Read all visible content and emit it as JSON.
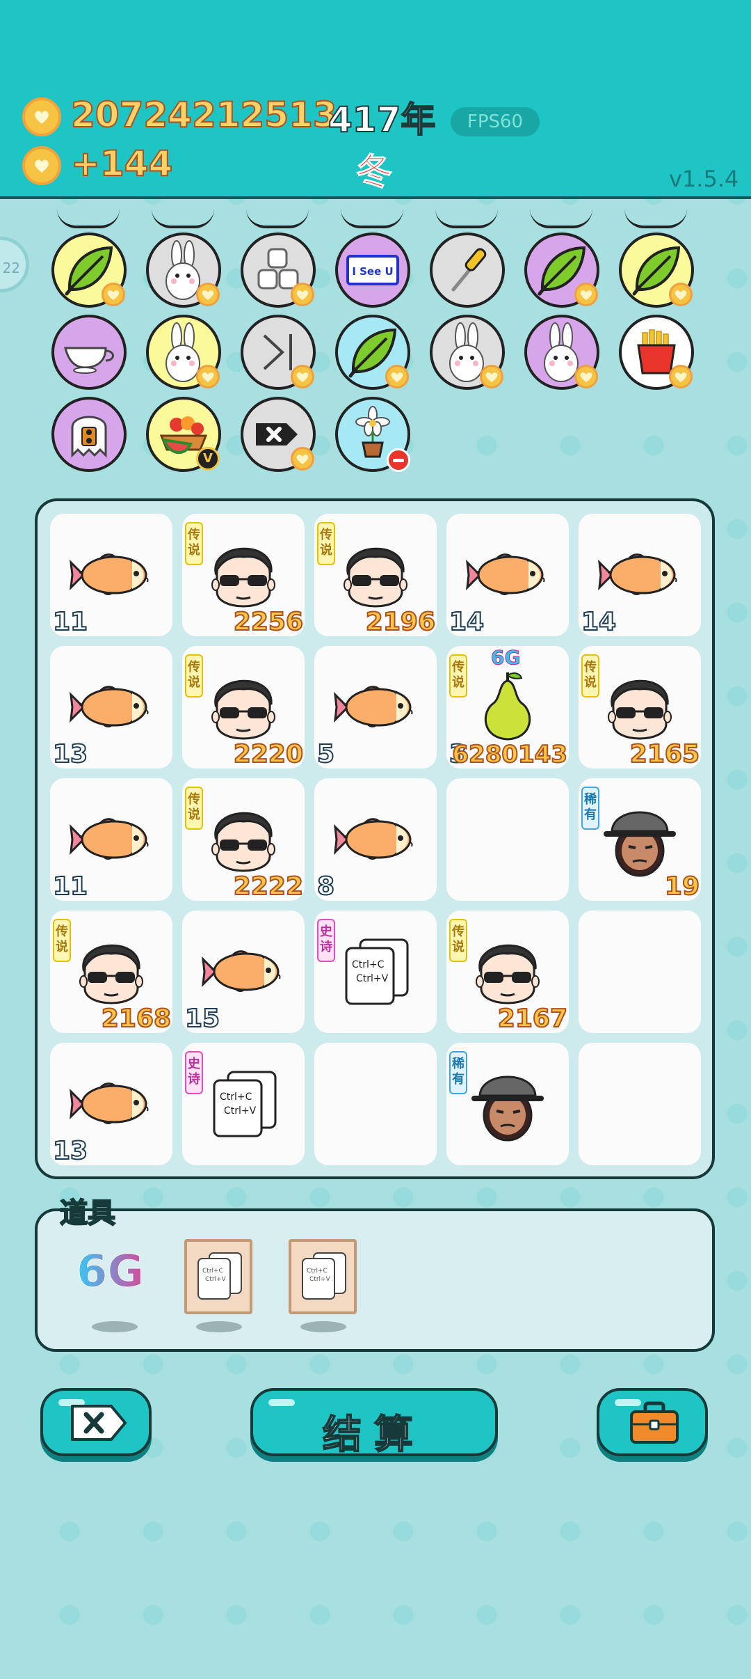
{
  "hud": {
    "coins": "20724212513",
    "income": "+144",
    "year": "417年",
    "season": "冬",
    "fps": "FPS60",
    "version": "v1.5.4",
    "side_badge": "22"
  },
  "inventory_items": [
    {
      "icon": "leaf-icon",
      "bg": "#fbfa9a",
      "heart": true
    },
    {
      "icon": "rabbit-icon",
      "bg": "#dedede",
      "heart": true
    },
    {
      "icon": "sugar-cubes-icon",
      "bg": "#dedede",
      "heart": true
    },
    {
      "icon": "i-see-u-sign-icon",
      "bg": "#d7a6ea",
      "heart": false,
      "text": "I See U"
    },
    {
      "icon": "screwdriver-icon",
      "bg": "#dedede",
      "heart": false
    },
    {
      "icon": "leaf-icon",
      "bg": "#d7a6ea",
      "heart": true
    },
    {
      "icon": "leaf-icon",
      "bg": "#fbfa9a",
      "heart": true
    },
    {
      "icon": "gravy-boat-icon",
      "bg": "#d7a6ea",
      "heart": false
    },
    {
      "icon": "rabbit-icon",
      "bg": "#fbfa9a",
      "heart": true
    },
    {
      "icon": "skip-icon",
      "bg": "#dedede",
      "heart": true
    },
    {
      "icon": "leaf-icon",
      "bg": "#a6e8f4",
      "heart": true
    },
    {
      "icon": "rabbit-icon",
      "bg": "#dedede",
      "heart": true
    },
    {
      "icon": "rabbit-icon",
      "bg": "#d7a6ea",
      "heart": true
    },
    {
      "icon": "fries-icon",
      "bg": "#ffffff",
      "heart": true
    },
    {
      "icon": "ghost-icon",
      "bg": "#d7a6ea",
      "heart": false
    },
    {
      "icon": "fruit-basket-icon",
      "bg": "#fbfa9a",
      "heart": false,
      "badge": "V"
    },
    {
      "icon": "delete-key-icon",
      "bg": "#dedede",
      "heart": true
    },
    {
      "icon": "flower-pot-icon",
      "bg": "#a6e8f4",
      "heart": false,
      "minus": true
    }
  ],
  "board_cells": [
    {
      "icon": "fish-icon",
      "left_num": "11"
    },
    {
      "icon": "sunglasses-man-icon",
      "tag": "传说",
      "tag_type": "legend",
      "right_num": "2256"
    },
    {
      "icon": "sunglasses-man-icon",
      "tag": "传说",
      "tag_type": "legend",
      "right_num": "2196"
    },
    {
      "icon": "fish-icon",
      "left_num": "14"
    },
    {
      "icon": "fish-icon",
      "left_num": "14"
    },
    {
      "icon": "fish-icon",
      "left_num": "13"
    },
    {
      "icon": "sunglasses-man-icon",
      "tag": "传说",
      "tag_type": "legend",
      "right_num": "2220"
    },
    {
      "icon": "fish-icon",
      "left_num": "5"
    },
    {
      "icon": "pear-icon",
      "tag": "传说",
      "tag_type": "legend",
      "left_num": "3",
      "right_num": "6280143",
      "top_label": "6G"
    },
    {
      "icon": "sunglasses-man-icon",
      "tag": "传说",
      "tag_type": "legend",
      "right_num": "2165"
    },
    {
      "icon": "fish-icon",
      "left_num": "11"
    },
    {
      "icon": "sunglasses-man-icon",
      "tag": "传说",
      "tag_type": "legend",
      "right_num": "2222"
    },
    {
      "icon": "fish-icon",
      "left_num": "8"
    },
    {
      "icon": "empty"
    },
    {
      "icon": "bucket-hat-man-icon",
      "tag": "稀有",
      "tag_type": "rare",
      "right_num": "19"
    },
    {
      "icon": "sunglasses-man-icon",
      "tag": "传说",
      "tag_type": "legend",
      "right_num": "2168"
    },
    {
      "icon": "fish-icon",
      "left_num": "15"
    },
    {
      "icon": "copy-paste-icon",
      "tag": "史诗",
      "tag_type": "epic"
    },
    {
      "icon": "sunglasses-man-icon",
      "tag": "传说",
      "tag_type": "legend",
      "right_num": "2167"
    },
    {
      "icon": "empty"
    },
    {
      "icon": "fish-icon",
      "left_num": "13"
    },
    {
      "icon": "copy-paste-icon",
      "tag": "史诗",
      "tag_type": "epic"
    },
    {
      "icon": "empty"
    },
    {
      "icon": "bucket-hat-man-icon",
      "tag": "稀有",
      "tag_type": "rare"
    },
    {
      "icon": "empty"
    }
  ],
  "copy_paste_text": {
    "line1": "Ctrl+C",
    "line2": "Ctrl+V"
  },
  "tools": {
    "label": "道具",
    "items": [
      {
        "icon": "6g-icon",
        "text": "6G"
      },
      {
        "icon": "copy-paste-card-icon"
      },
      {
        "icon": "copy-paste-card-icon"
      }
    ]
  },
  "buttons": {
    "cancel_icon": "close-tag-icon",
    "settle_label": "结算",
    "bag_icon": "briefcase-icon"
  },
  "colors": {
    "header": "#1fc4c4",
    "background": "#a8e0e2",
    "coin": "#f6c343",
    "number_text": "#f8c64a"
  }
}
